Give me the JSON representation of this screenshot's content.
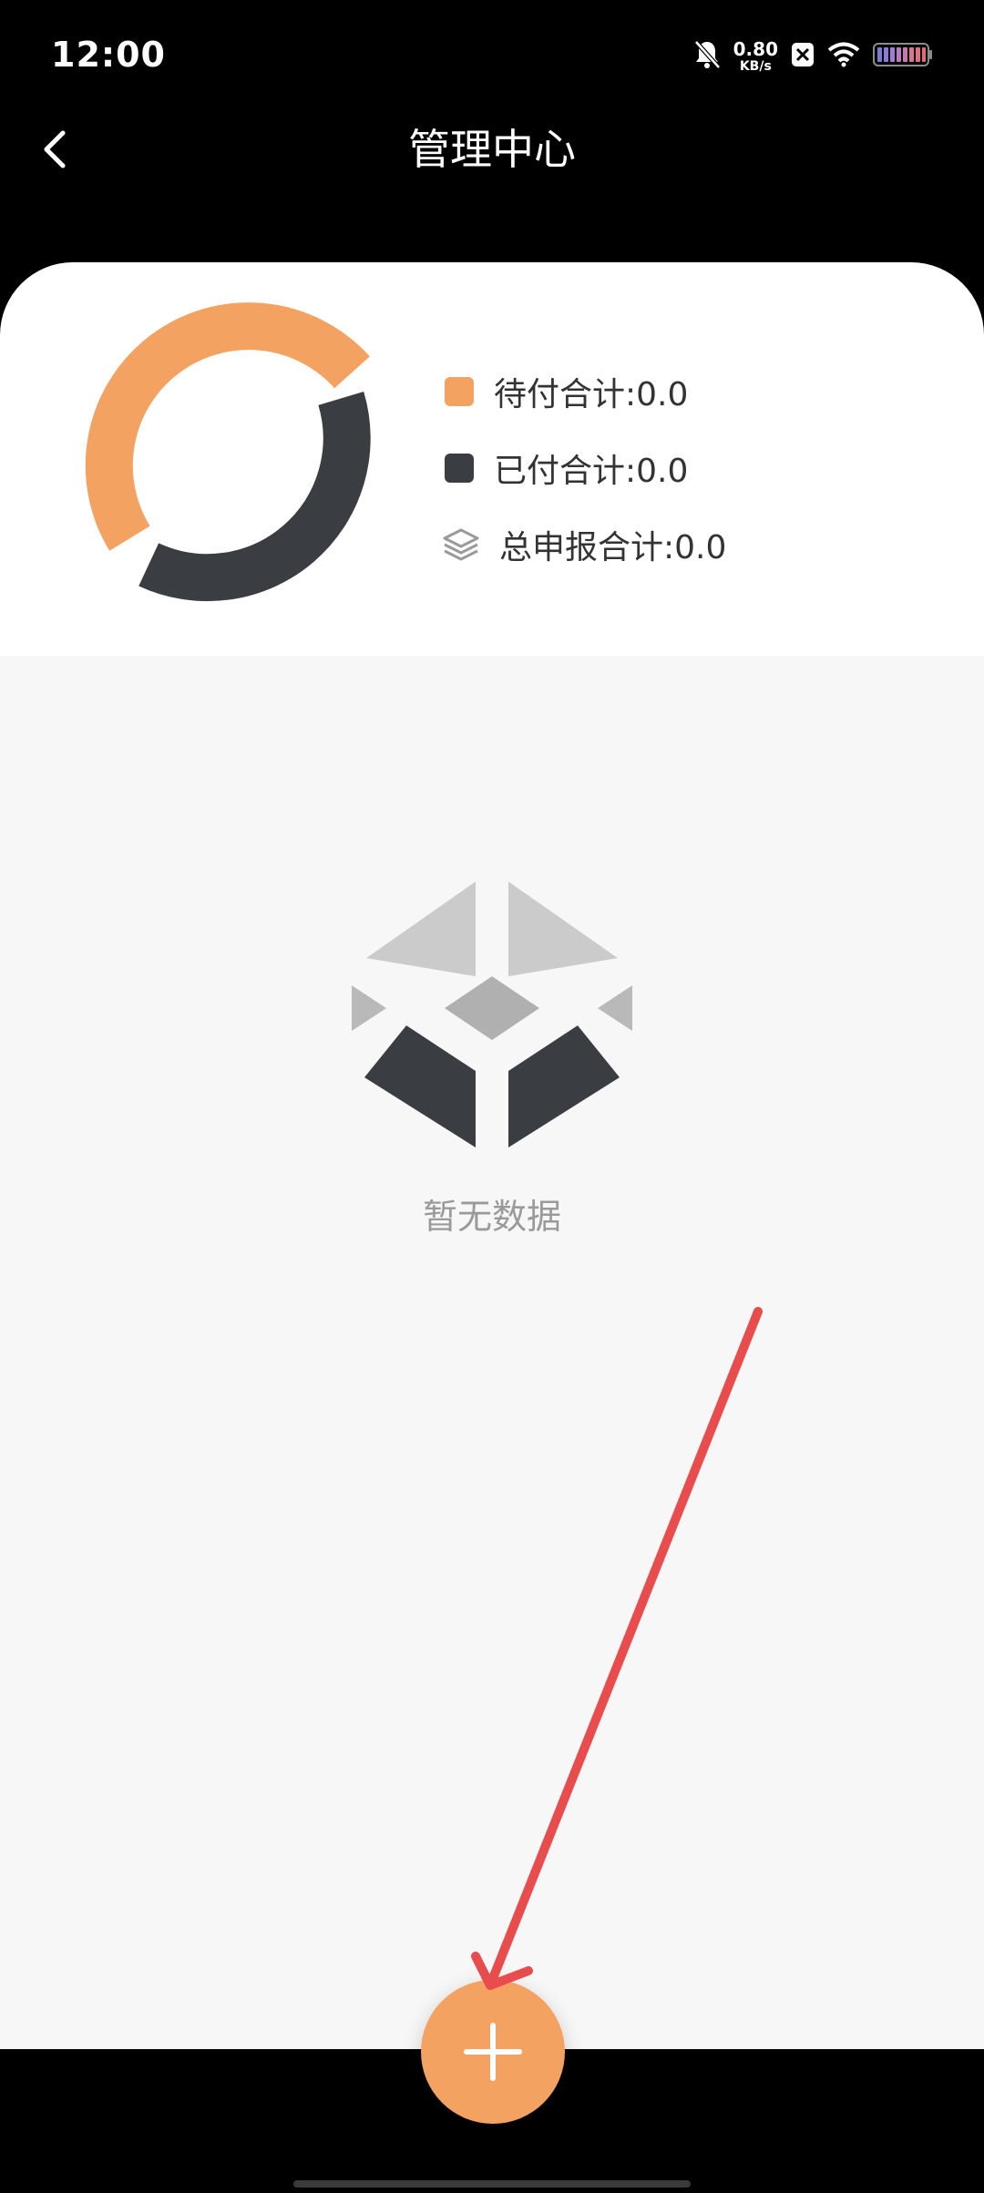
{
  "status_bar": {
    "time": "12:00",
    "net_speed_value": "0.80",
    "net_speed_unit": "KB/s",
    "icons": [
      "bell-muted-icon",
      "close-box-icon",
      "wifi-icon",
      "battery-icon"
    ]
  },
  "header": {
    "title": "管理中心",
    "back_icon": "chevron-left-icon"
  },
  "summary": {
    "pending_label": "待付合计:0.0",
    "paid_label": "已付合计:0.0",
    "total_label": "总申报合计:0.0",
    "colors": {
      "pending": "#f4a261",
      "paid": "#3a3d42",
      "total_icon": "#9a9a9a"
    }
  },
  "empty_state": {
    "text": "暂无数据",
    "icon": "empty-box-icon"
  },
  "fab": {
    "icon": "plus-icon",
    "color": "#f4a261"
  },
  "annotation": {
    "arrow_color": "#e84c4c"
  }
}
